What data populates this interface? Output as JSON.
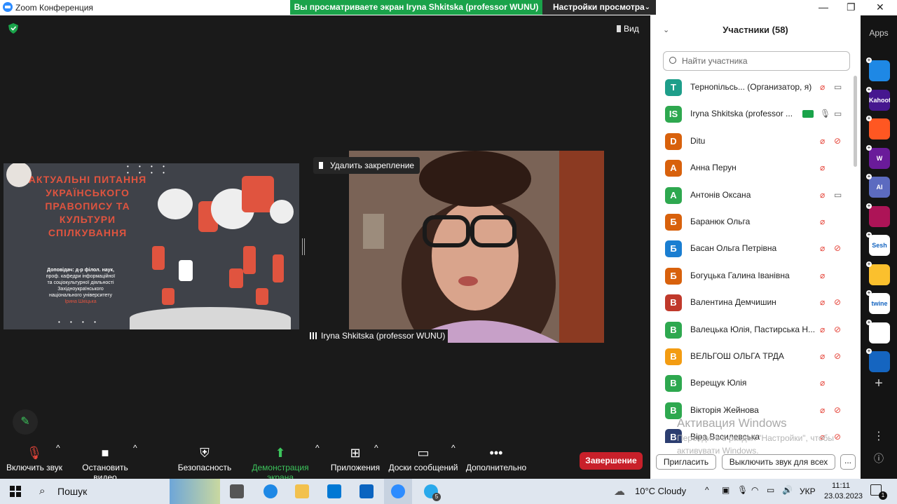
{
  "window": {
    "title": "Zoom Конференция"
  },
  "share_banner": {
    "text": "Вы просматриваете экран Iryna Shkitska (professor WUNU)",
    "view_settings": "Настройки просмотра"
  },
  "stage": {
    "view_label": "Вид",
    "unpin_label": "Удалить закрепление",
    "speaker_name": "Iryna Shkitska (professor WUNU)"
  },
  "slide": {
    "title": "АКТУАЛЬНІ ПИТАННЯ УКРАЇНСЬКОГО ПРАВОПИСУ ТА КУЛЬТУРИ СПІЛКУВАННЯ",
    "author_lines": [
      "Доповідач: д-р філол. наук,",
      "проф. кафедри інформаційної",
      "та соціокультурної діяльності",
      "Західноукраїнського",
      "національного університету"
    ],
    "author_name": "Ірина Шкіцька"
  },
  "toolbar": {
    "unmute": "Включить звук",
    "stop_video": "Остановить видео",
    "security": "Безопасность",
    "share": "Демонстрация экрана",
    "apps": "Приложения",
    "whiteboards": "Доски сообщений",
    "more": "Дополнительно",
    "end": "Завершение"
  },
  "participants": {
    "header": "Участники (58)",
    "search_placeholder": "Найти участника",
    "invite": "Пригласить",
    "mute_all": "Выключить звук для всех",
    "more": "...",
    "items": [
      {
        "initial": "Т",
        "name": "Тернопільсь...  (Организатор, я)",
        "color": "#1e9e8a",
        "mic": "muted",
        "cam": "on"
      },
      {
        "initial": "IS",
        "name": "Iryna Shkitska (professor ...",
        "color": "#2ea84f",
        "mic": "on",
        "cam": "on",
        "sharing": true
      },
      {
        "initial": "D",
        "name": "Ditu",
        "color": "#d8610c",
        "mic": "muted",
        "cam": "off"
      },
      {
        "initial": "А",
        "name": "Анна Перун",
        "color": "#d8610c",
        "mic": "muted",
        "cam": "none"
      },
      {
        "initial": "А",
        "name": "Антонів Оксана",
        "color": "#2ea84f",
        "mic": "muted",
        "cam": "on"
      },
      {
        "initial": "Б",
        "name": "Баранюк Ольга",
        "color": "#d8610c",
        "mic": "muted",
        "cam": "none"
      },
      {
        "initial": "Б",
        "name": "Басан Ольга Петрівна",
        "color": "#1a7ed1",
        "mic": "muted",
        "cam": "off"
      },
      {
        "initial": "Б",
        "name": "Богуцька Галина Іванівна",
        "color": "#d8610c",
        "mic": "muted",
        "cam": "none"
      },
      {
        "initial": "В",
        "name": "Валентина Демчишин",
        "color": "#c0392b",
        "mic": "muted",
        "cam": "off"
      },
      {
        "initial": "В",
        "name": "Валецька Юлія, Пастирська Н...",
        "color": "#2ea84f",
        "mic": "muted",
        "cam": "off"
      },
      {
        "initial": "В",
        "name": "ВЕЛЬГОШ ОЛЬГА ТРДА",
        "color": "#f39c12",
        "mic": "muted",
        "cam": "off"
      },
      {
        "initial": "В",
        "name": "Верещук Юлія",
        "color": "#2ea84f",
        "mic": "muted",
        "cam": "none"
      },
      {
        "initial": "В",
        "name": "Вікторія Жейнова",
        "color": "#2ea84f",
        "mic": "muted",
        "cam": "off"
      },
      {
        "initial": "В",
        "name": "Віра Василевська",
        "color": "#2c3e70",
        "mic": "muted",
        "cam": "off"
      }
    ]
  },
  "watermark": {
    "line1": "Активация Windows",
    "line2": "Перейдите в раздел \"Настройки\", чтобы активувати Windows."
  },
  "apps_sidebar": {
    "label": "Apps",
    "items": [
      {
        "name": "zoom-docs",
        "color": "#1e88e5",
        "text": ""
      },
      {
        "name": "kahoot",
        "color": "#46178f",
        "text": "Kahoot!"
      },
      {
        "name": "app3",
        "color": "#ff5722",
        "text": ""
      },
      {
        "name": "wordwall",
        "color": "#6a1b9a",
        "text": "W"
      },
      {
        "name": "ai-app",
        "color": "#5c6bc0",
        "text": "AI"
      },
      {
        "name": "app6",
        "color": "#ad1457",
        "text": ""
      },
      {
        "name": "sesh",
        "color": "#ffffff",
        "text": "Sesh"
      },
      {
        "name": "app8",
        "color": "#fbc02d",
        "text": ""
      },
      {
        "name": "twine",
        "color": "#ffffff",
        "text": "twine"
      },
      {
        "name": "app10",
        "color": "#ffffff",
        "text": ""
      },
      {
        "name": "app11",
        "color": "#1565c0",
        "text": ""
      }
    ]
  },
  "taskbar": {
    "search": "Пошук",
    "weather": "10°C  Cloudy",
    "lang": "УКР",
    "time": "11:11",
    "date": "23.03.2023",
    "telegram_badge": "5",
    "notif_badge": "1"
  }
}
